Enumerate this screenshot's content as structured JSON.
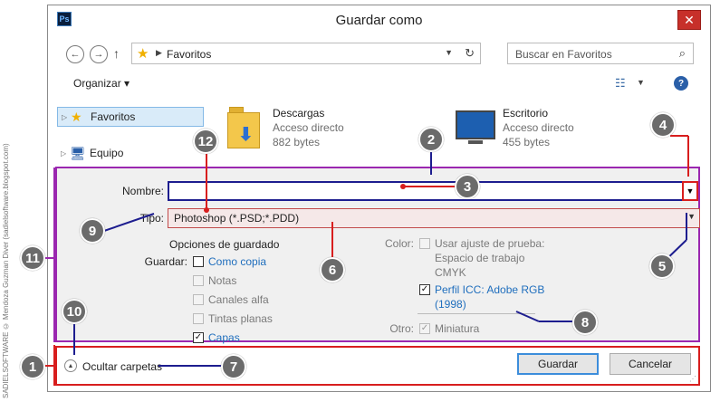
{
  "watermark": "SADIELSOFTWARE © Mendoza Guzman Diver (sadielsoftware.blogspot.com)",
  "titlebar": {
    "app_icon": "Ps",
    "title": "Guardar como",
    "close": "✕"
  },
  "navigation": {
    "back_icon": "back-arrow-icon",
    "forward_icon": "forward-arrow-icon",
    "breadcrumb": "Favoritos",
    "search_placeholder": "Buscar en Favoritos"
  },
  "toolbar": {
    "organize_label": "Organizar ▾",
    "help_label": "?"
  },
  "navpane": {
    "items": [
      {
        "label": "Favoritos",
        "icon": "star-icon"
      },
      {
        "label": "Equipo",
        "icon": "computer-icon"
      }
    ]
  },
  "files": [
    {
      "name": "Descargas",
      "type": "Acceso directo",
      "size": "882 bytes",
      "icon": "downloads-folder-icon"
    },
    {
      "name": "Escritorio",
      "type": "Acceso directo",
      "size": "455 bytes",
      "icon": "desktop-icon"
    }
  ],
  "save_form": {
    "name_label": "Nombre:",
    "name_value": "",
    "type_label": "Tipo:",
    "type_value": "Photoshop (*.PSD;*.PDD)",
    "options_title": "Opciones de guardado",
    "save_label": "Guardar:",
    "save_options": [
      {
        "label": "Como copia",
        "checked": false,
        "enabled": true
      },
      {
        "label": "Notas",
        "checked": false,
        "enabled": false
      },
      {
        "label": "Canales alfa",
        "checked": false,
        "enabled": false
      },
      {
        "label": "Tintas planas",
        "checked": false,
        "enabled": false
      },
      {
        "label": "Capas",
        "checked": true,
        "enabled": true
      }
    ],
    "color_label": "Color:",
    "proof_label_1": "Usar ajuste de prueba:",
    "proof_label_2": "Espacio de trabajo",
    "proof_label_3": "CMYK",
    "icc_label_1": "Perfil ICC: Adobe RGB",
    "icc_label_2": "(1998)",
    "other_label": "Otro:",
    "thumbnail_label": "Miniatura"
  },
  "footer": {
    "hide_folders_label": "Ocultar carpetas",
    "save_button": "Guardar",
    "cancel_button": "Cancelar"
  },
  "callouts": [
    "1",
    "2",
    "3",
    "4",
    "5",
    "6",
    "7",
    "8",
    "9",
    "10",
    "11",
    "12"
  ],
  "colors": {
    "purple_frame": "#9b27b0",
    "red_frame": "#d81e1e",
    "blue_line": "#1d1d8f",
    "badge": "#6b6b6b"
  }
}
